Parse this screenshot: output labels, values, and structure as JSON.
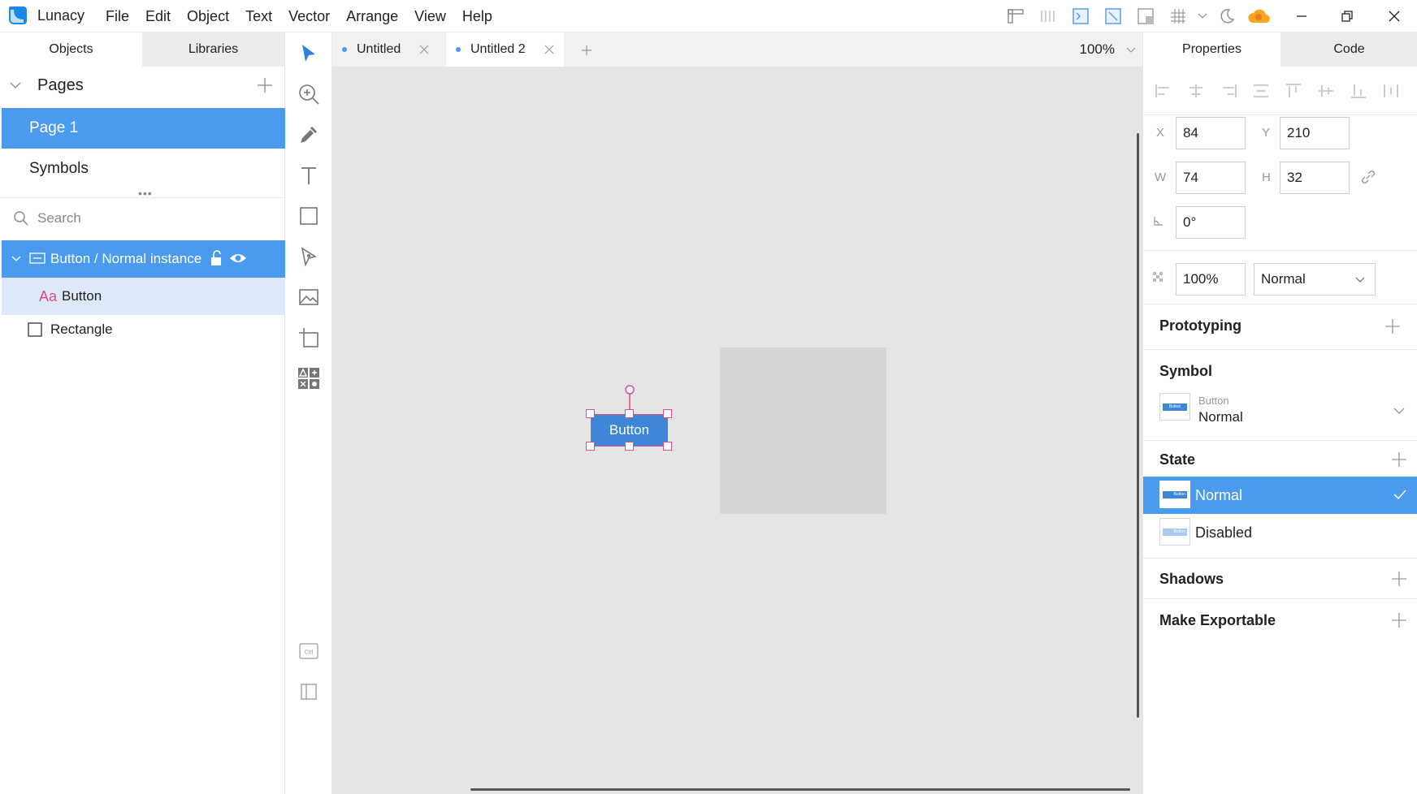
{
  "app": {
    "name": "Lunacy"
  },
  "menu": [
    "File",
    "Edit",
    "Object",
    "Text",
    "Vector",
    "Arrange",
    "View",
    "Help"
  ],
  "left_panel": {
    "tabs": [
      "Objects",
      "Libraries"
    ],
    "pages_title": "Pages",
    "pages": [
      "Page 1",
      "Symbols"
    ],
    "search_placeholder": "Search",
    "layers": [
      {
        "label": "Button / Normal instance",
        "icon": "symbol-instance-icon"
      },
      {
        "label": "Button",
        "icon": "text-layer-icon",
        "icon_text": "Aa"
      },
      {
        "label": "Rectangle",
        "icon": "rectangle-layer-icon"
      }
    ]
  },
  "doc_tabs": [
    "Untitled",
    "Untitled 2"
  ],
  "zoom": "100%",
  "canvas": {
    "button_label": "Button"
  },
  "right_panel": {
    "tabs": [
      "Properties",
      "Code"
    ],
    "x_label": "X",
    "x": "84",
    "y_label": "Y",
    "y": "210",
    "w_label": "W",
    "w": "74",
    "h_label": "H",
    "h": "32",
    "rotation": "0°",
    "opacity": "100%",
    "blend": "Normal",
    "prototyping": "Prototyping",
    "symbol_title": "Symbol",
    "symbol_name": "Button",
    "symbol_state": "Normal",
    "thumb_text": "Button",
    "state_title": "State",
    "states": [
      "Normal",
      "Disabled"
    ],
    "shadows": "Shadows",
    "export": "Make Exportable"
  },
  "colors": {
    "accent": "#4a9aef",
    "selection": "#e24a8a",
    "canvas": "#e5e5e5"
  }
}
